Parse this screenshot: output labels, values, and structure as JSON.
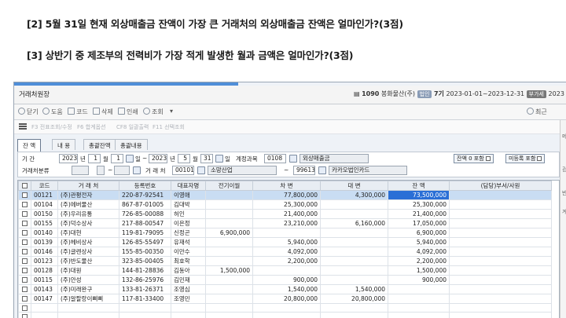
{
  "questions": {
    "q2": "[2] 5월 31일 현재 외상매출금 잔액이 가장 큰 거래처의 외상매출금 잔액은 얼마인가?(3점)",
    "q3": "[3] 상반기 중 제조부의 전력비가 가장 적게 발생한 월과 금액은 얼마인가?(3점)"
  },
  "window": {
    "title": "거래처원장",
    "company_code": "1090",
    "company_name": "봉화물산(주)",
    "tag_law": "법인",
    "period_prefix": "7기",
    "period": "2023-01-01~2023-12-31",
    "tag_year": "부가세",
    "year": "2023"
  },
  "toolbar": {
    "items": [
      "닫기",
      "도움",
      "코드",
      "삭제",
      "인쇄",
      "조회"
    ],
    "more": "▾",
    "recent": "최근",
    "right": "코드"
  },
  "fkeys": [
    "F3 전표조회/수정",
    "F6 합계옵션",
    "CF8 일괄출력",
    "F11 선택조회"
  ],
  "tabs": [
    "잔 액",
    "내 용",
    "총괄잔액",
    "총괄내용"
  ],
  "filters": {
    "period_label": "기    간",
    "year_from": "2023",
    "year_unit": "년",
    "month_from": "1",
    "month_unit": "월",
    "day_from": "1",
    "day_unit": "일",
    "tilde": "~",
    "year_to": "2023",
    "month_to": "5",
    "day_to": "31",
    "account_label": "계정과목",
    "account_code": "0108",
    "account_name": "외상매출금",
    "balance_zero": "잔액 0 포함",
    "unregistered": "미등록 포함",
    "partner_class_label": "거래처분류",
    "partner_label": "거 래 처",
    "partner_from_code": "00101",
    "partner_from_name": "소망산업",
    "partner_to_code": "99613",
    "partner_to_name": "카카오법인카드"
  },
  "table": {
    "headers": [
      "",
      "코드",
      "거 래 처",
      "등록번호",
      "대표자명",
      "전기이월",
      "차    변",
      "대    변",
      "잔    액",
      "(담당)부서/사원"
    ],
    "rows": [
      [
        "00121",
        "(주)관평전자",
        "220-87-92541",
        "이영애",
        "",
        "77,800,000",
        "4,300,000",
        "73,500,000"
      ],
      [
        "00104",
        "(주)에버물산",
        "867-87-01005",
        "김대박",
        "",
        "25,300,000",
        "",
        "25,300,000"
      ],
      [
        "00150",
        "(주)우리유통",
        "726-85-00088",
        "허인",
        "",
        "21,400,000",
        "",
        "21,400,000"
      ],
      [
        "00155",
        "(주)덕수상사",
        "217-88-00547",
        "이은정",
        "",
        "23,210,000",
        "6,160,000",
        "17,050,000"
      ],
      [
        "00140",
        "(주)대현",
        "119-81-79095",
        "신정곤",
        "6,900,000",
        "",
        "",
        "6,900,000"
      ],
      [
        "00139",
        "(주)헤비상사",
        "126-85-55497",
        "유재석",
        "",
        "5,940,000",
        "",
        "5,940,000"
      ],
      [
        "00146",
        "(주)글렌상사",
        "155-85-00350",
        "이만수",
        "",
        "4,092,000",
        "",
        "4,092,000"
      ],
      [
        "00123",
        "(주)반도물산",
        "323-85-00405",
        "최호학",
        "",
        "2,200,000",
        "",
        "2,200,000"
      ],
      [
        "00128",
        "(주)대원",
        "144-81-28836",
        "김동아",
        "1,500,000",
        "",
        "",
        "1,500,000"
      ],
      [
        "00115",
        "(주)안성",
        "132-86-25976",
        "김민재",
        "",
        "900,000",
        "",
        "900,000"
      ],
      [
        "00143",
        "(주)미래완구",
        "133-81-26371",
        "조영심",
        "",
        "1,540,000",
        "1,540,000",
        ""
      ],
      [
        "00147",
        "(주)알팔랑이삐삐",
        "117-81-33400",
        "조영민",
        "",
        "20,800,000",
        "20,800,000",
        ""
      ]
    ]
  },
  "side": {
    "labels": [
      "메",
      "검",
      "반",
      "계"
    ]
  },
  "colors": {
    "highlight": "#2a6fd6",
    "selected_row": "#c9ddf3",
    "accent_strip": "#4f8ed8"
  }
}
